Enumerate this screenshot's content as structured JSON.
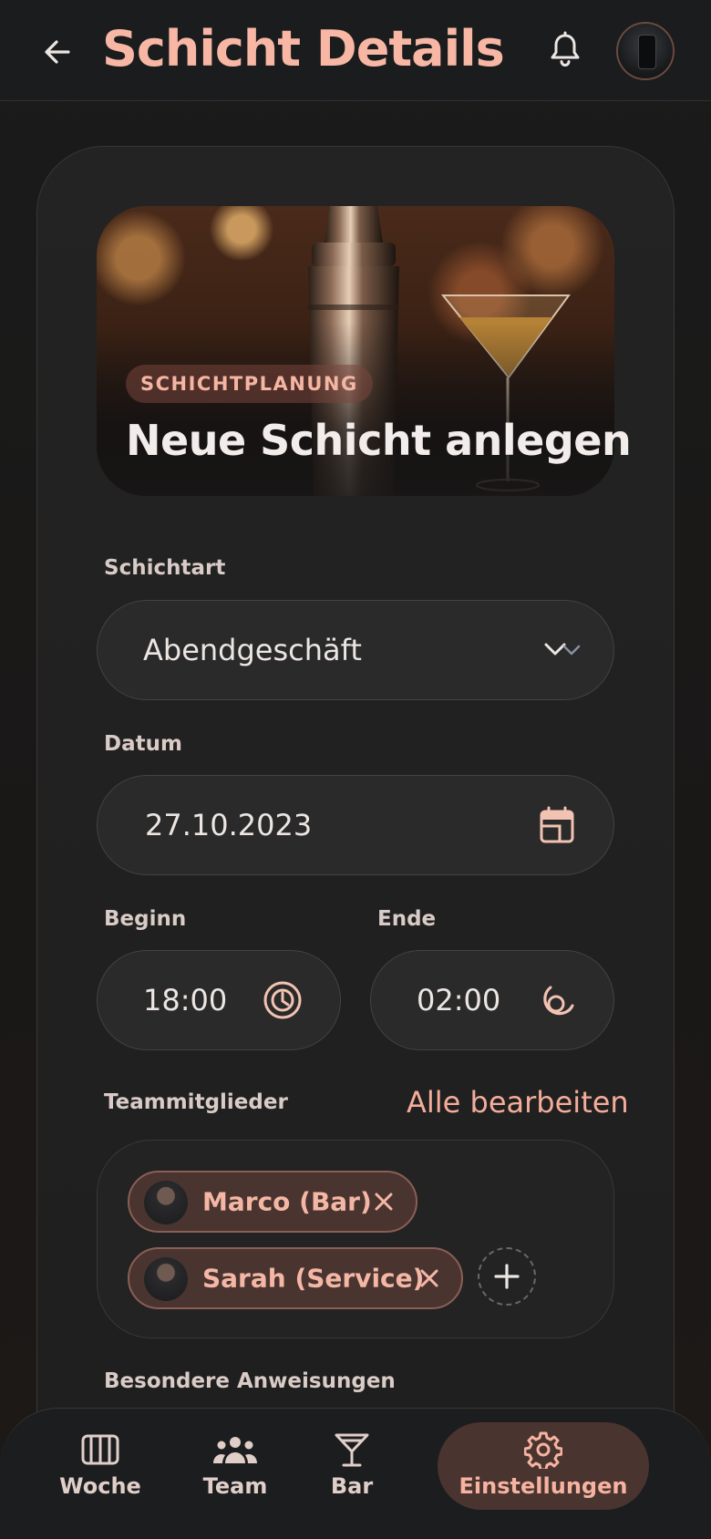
{
  "header": {
    "title": "Schicht Details"
  },
  "hero": {
    "badge": "SCHICHTPLANUNG",
    "title": "Neue Schicht anlegen"
  },
  "form": {
    "shift_type": {
      "label": "Schichtart",
      "value": "Abendgeschäft"
    },
    "date": {
      "label": "Datum",
      "value": "27.10.2023"
    },
    "start": {
      "label": "Beginn",
      "value": "18:00"
    },
    "end": {
      "label": "Ende",
      "value": "02:00"
    },
    "team": {
      "label": "Teammitglieder",
      "edit_all": "Alle bearbeiten",
      "members": [
        {
          "name": "Marco (Bar)"
        },
        {
          "name": "Sarah (Service)"
        }
      ]
    },
    "instructions": {
      "label": "Besondere Anweisungen"
    }
  },
  "nav": {
    "items": [
      {
        "label": "Woche",
        "icon": "calendar-week-icon"
      },
      {
        "label": "Team",
        "icon": "group-icon"
      },
      {
        "label": "Bar",
        "icon": "cocktail-glass-icon"
      },
      {
        "label": "Einstellungen",
        "icon": "gear-icon",
        "active": true
      }
    ]
  },
  "colors": {
    "accent": "#f7b7a4",
    "background": "#1b1b1b",
    "chip": "#4a3430"
  }
}
